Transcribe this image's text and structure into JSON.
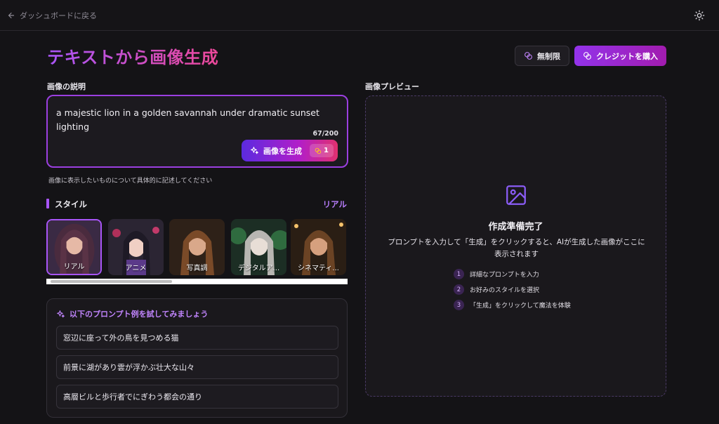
{
  "topbar": {
    "back_label": "ダッシュボードに戻る"
  },
  "header": {
    "title": "テキストから画像生成",
    "unlimited_label": "無制限",
    "buy_label": "クレジットを購入"
  },
  "prompt": {
    "section_label": "画像の説明",
    "value": "a majestic lion in a golden savannah under dramatic sunset lighting",
    "counter": "67/200",
    "generate_label": "画像を生成",
    "cost": "1",
    "hint": "画像に表示したいものについて具体的に記述してください"
  },
  "style": {
    "title": "スタイル",
    "current": "リアル",
    "items": [
      {
        "label": "リアル",
        "selected": true
      },
      {
        "label": "アニメ",
        "selected": false
      },
      {
        "label": "写真調",
        "selected": false
      },
      {
        "label": "デジタルア...",
        "selected": false
      },
      {
        "label": "シネマティ...",
        "selected": false
      }
    ]
  },
  "examples": {
    "heading": "以下のプロンプト例を試してみましょう",
    "items": [
      "窓辺に座って外の鳥を見つめる猫",
      "前景に湖があり雲が浮かぶ壮大な山々",
      "高層ビルと歩行者でにぎわう都会の通り"
    ]
  },
  "preview": {
    "section_label": "画像プレビュー",
    "title": "作成準備完了",
    "description": "プロンプトを入力して「生成」をクリックすると、AIが生成した画像がここに表示されます",
    "steps": [
      {
        "num": "1",
        "text": "詳細なプロンプトを入力"
      },
      {
        "num": "2",
        "text": "お好みのスタイルを選択"
      },
      {
        "num": "3",
        "text": "「生成」をクリックして魔法を体験"
      }
    ]
  },
  "colors": {
    "accent": "#a855f7",
    "pink": "#ec4899",
    "background": "#141316"
  }
}
